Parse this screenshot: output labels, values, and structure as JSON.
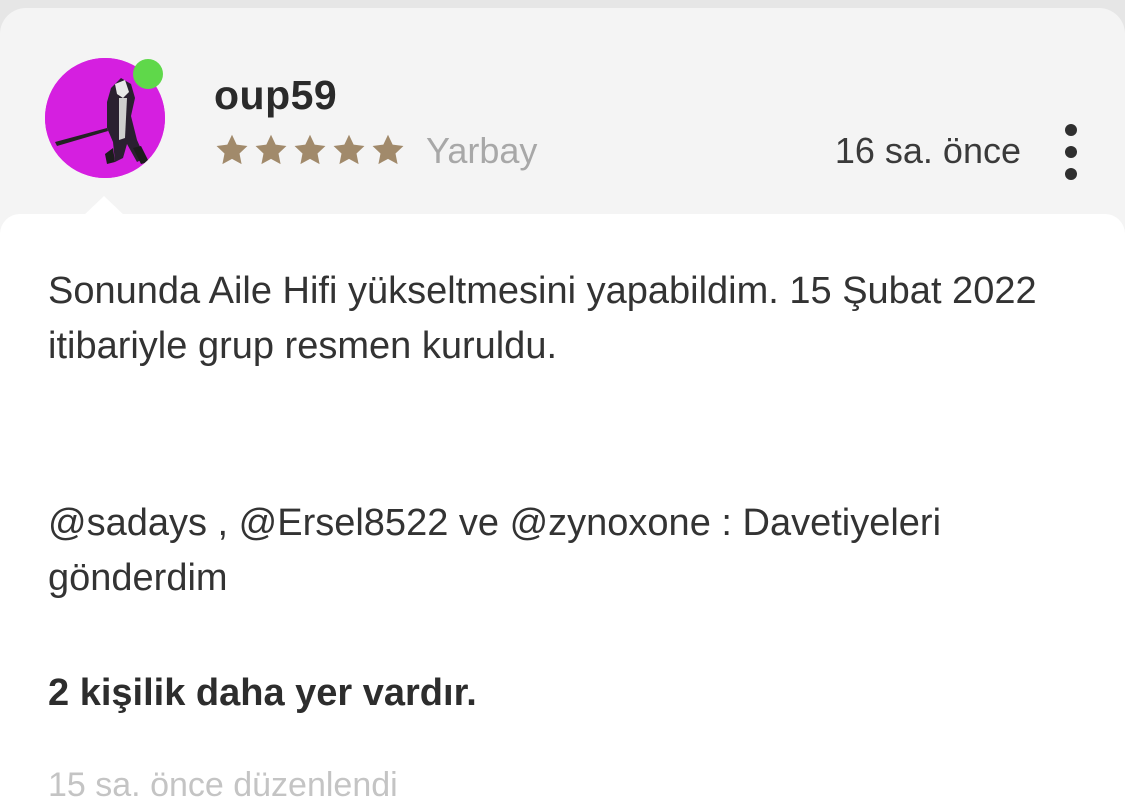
{
  "post": {
    "username": "oup59",
    "rank": "Yarbay",
    "rating_stars": 5,
    "star_color": "#a18a6b",
    "time": "16 sa. önce",
    "paragraphs": [
      "Sonunda Aile Hifi yükseltmesini yapabildim. 15 Şubat 2022 itibariyle grup resmen kuruldu.",
      "@sadays , @Ersel8522 ve @zynoxone : Davetiyeleri gönderdim",
      "2 kişilik daha yer vardır."
    ],
    "edited": "15 sa. önce düzenlendi"
  },
  "colors": {
    "avatar_bg": "#d51fe0",
    "online": "#5fd84a",
    "header_bg": "#f4f4f4",
    "body_bg": "#ffffff"
  },
  "icons": {
    "avatar": "avatar-image",
    "online": "online-status-icon",
    "star": "star-icon",
    "more": "more-vertical-icon"
  }
}
